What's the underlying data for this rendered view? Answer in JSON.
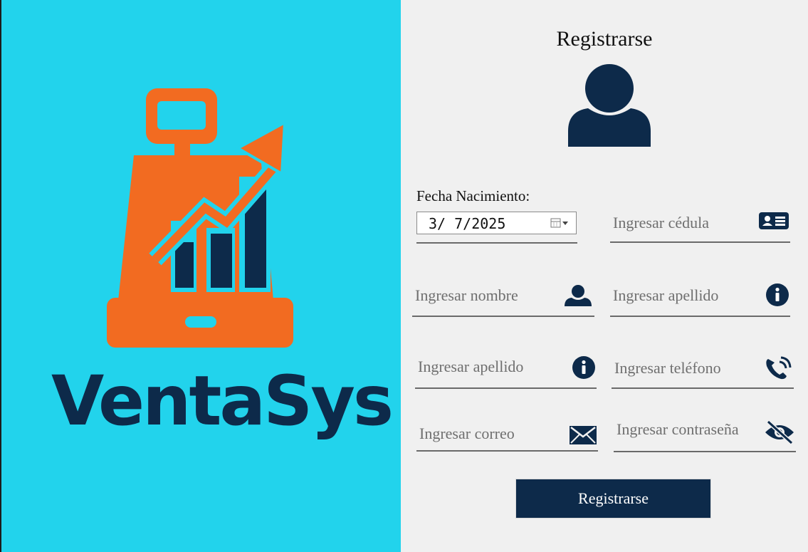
{
  "brand": {
    "name": "VentaSys"
  },
  "form": {
    "title": "Registrarse",
    "date_label": "Fecha Nacimiento:",
    "date_value": "3/  7/2025",
    "cedula_placeholder": "Ingresar cédula",
    "nombre_placeholder": "Ingresar nombre",
    "apellido1_placeholder": "Ingresar apellido",
    "apellido2_placeholder": "Ingresar apellido",
    "telefono_placeholder": "Ingresar teléfono",
    "correo_placeholder": "Ingresar correo",
    "contrasena_placeholder": "Ingresar contraseña",
    "submit_label": "Registrarse"
  },
  "colors": {
    "cyan": "#22d3ec",
    "navy": "#0d2a4a",
    "orange": "#f26b21",
    "panel": "#f0f0f0"
  }
}
